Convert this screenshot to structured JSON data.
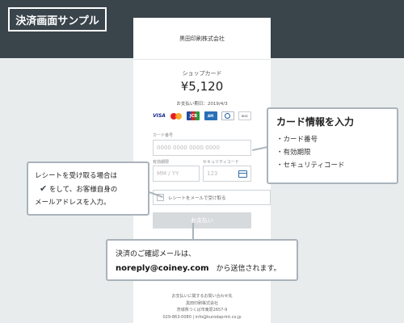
{
  "page_title": "決済画面サンプル",
  "checkout": {
    "merchant_name": "黒田印刷株式会社",
    "shop_label": "ショップカード",
    "amount": "¥5,120",
    "due_date": "お支払い期日：2019/4/3",
    "card_brands": [
      "VISA",
      "Mastercard",
      "JCB",
      "AMEX",
      "Diners Club",
      "DISCOVER"
    ],
    "card_number_label": "カード番号",
    "card_number_placeholder": "0000 0000 0000 0000",
    "expiry_label": "有効期限",
    "expiry_placeholder": "MM / YY",
    "security_label": "セキュリティコード",
    "security_placeholder": "123",
    "receipt_checkbox_label": "レシートをメールで受け取る",
    "receipt_checked": false,
    "pay_button": "お支払い",
    "footer": {
      "inquiry": "お支払いに関するお問い合わせ先",
      "company": "黒田印刷株式会社",
      "address": "茨城県つくば市東原2657-9",
      "contact": "029-863-0080 | info@kurodaprint.co.jp"
    }
  },
  "callouts": {
    "card": {
      "title": "カード情報を入力",
      "items": [
        "・カード番号",
        "・有効期限",
        "・セキュリティコード"
      ]
    },
    "receipt": {
      "line1": "レシートを受け取る場合は",
      "line2": "をして、お客様自身の",
      "line3": "メールアドレスを入力。"
    },
    "email": {
      "line1": "決済のご確認メールは、",
      "address": "noreply@coiney.com",
      "suffix": "から送信されます。"
    }
  },
  "colors": {
    "header": "#39444b",
    "background": "#e9eced",
    "callout_border": "#aab3bb",
    "pay_button_disabled": "#d7dadd"
  }
}
